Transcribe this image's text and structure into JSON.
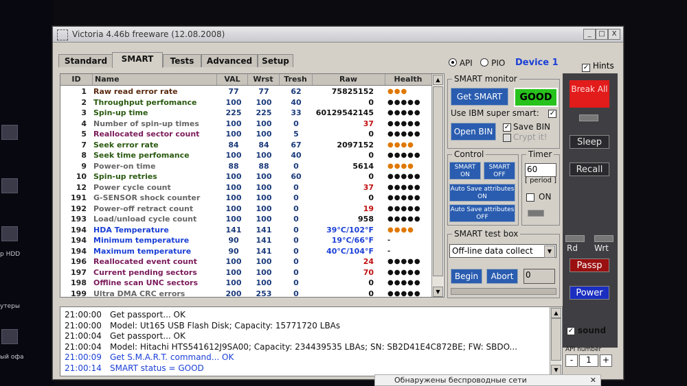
{
  "window": {
    "title": "Victoria 4.46b freeware (12.08.2008)",
    "minimize": "_",
    "maximize": "□",
    "close": "X"
  },
  "tabs": [
    "Standard",
    "SMART",
    "Tests",
    "Advanced",
    "Setup"
  ],
  "active_tab": "SMART",
  "mode": {
    "api": "API",
    "pio": "PIO",
    "selected": "API"
  },
  "device_label": "Device 1",
  "hints": {
    "label": "Hints",
    "checked": true
  },
  "table": {
    "headers": [
      "ID",
      "Name",
      "VAL",
      "Wrst",
      "Tresh",
      "Raw",
      "Health"
    ],
    "rows": [
      {
        "id": "1",
        "name": "Raw read error rate",
        "val": "77",
        "wrst": "77",
        "tresh": "62",
        "raw": "75825152",
        "health": "●●●",
        "name_color": "#5a2a10",
        "raw_color": "#111",
        "health_color": "#e07800"
      },
      {
        "id": "2",
        "name": "Throughput perfomance",
        "val": "100",
        "wrst": "100",
        "tresh": "40",
        "raw": "0",
        "health": "●●●●●",
        "name_color": "#2a5a10",
        "raw_color": "#111",
        "health_color": "#111"
      },
      {
        "id": "3",
        "name": "Spin-up time",
        "val": "225",
        "wrst": "225",
        "tresh": "33",
        "raw": "60129542145",
        "health": "●●●●●",
        "name_color": "#2a5a10",
        "raw_color": "#111",
        "health_color": "#111"
      },
      {
        "id": "4",
        "name": "Number of spin-up times",
        "val": "100",
        "wrst": "100",
        "tresh": "0",
        "raw": "37",
        "health": "●●●●●",
        "name_color": "#666",
        "raw_color": "#c01010",
        "health_color": "#111"
      },
      {
        "id": "5",
        "name": "Reallocated sector count",
        "val": "100",
        "wrst": "100",
        "tresh": "5",
        "raw": "0",
        "health": "●●●●●",
        "name_color": "#7a1a5a",
        "raw_color": "#111",
        "health_color": "#111"
      },
      {
        "id": "7",
        "name": "Seek error rate",
        "val": "84",
        "wrst": "84",
        "tresh": "67",
        "raw": "2097152",
        "health": "●●●●",
        "name_color": "#2a5a10",
        "raw_color": "#111",
        "health_color": "#e07800"
      },
      {
        "id": "8",
        "name": "Seek time perfomance",
        "val": "100",
        "wrst": "100",
        "tresh": "40",
        "raw": "0",
        "health": "●●●●●",
        "name_color": "#2a5a10",
        "raw_color": "#111",
        "health_color": "#111"
      },
      {
        "id": "9",
        "name": "Power-on time",
        "val": "88",
        "wrst": "88",
        "tresh": "0",
        "raw": "5614",
        "health": "●●●●",
        "name_color": "#666",
        "raw_color": "#111",
        "health_color": "#e07800"
      },
      {
        "id": "10",
        "name": "Spin-up retries",
        "val": "100",
        "wrst": "100",
        "tresh": "60",
        "raw": "0",
        "health": "●●●●●",
        "name_color": "#2a5a10",
        "raw_color": "#111",
        "health_color": "#111"
      },
      {
        "id": "12",
        "name": "Power cycle count",
        "val": "100",
        "wrst": "100",
        "tresh": "0",
        "raw": "37",
        "health": "●●●●●",
        "name_color": "#666",
        "raw_color": "#c01010",
        "health_color": "#111"
      },
      {
        "id": "191",
        "name": "G-SENSOR shock counter",
        "val": "100",
        "wrst": "100",
        "tresh": "0",
        "raw": "0",
        "health": "●●●●●",
        "name_color": "#666",
        "raw_color": "#111",
        "health_color": "#111"
      },
      {
        "id": "192",
        "name": "Power-off retract count",
        "val": "100",
        "wrst": "100",
        "tresh": "0",
        "raw": "19",
        "health": "●●●●●",
        "name_color": "#666",
        "raw_color": "#c01010",
        "health_color": "#111"
      },
      {
        "id": "193",
        "name": "Load/unload cycle count",
        "val": "100",
        "wrst": "100",
        "tresh": "0",
        "raw": "958",
        "health": "●●●●●",
        "name_color": "#666",
        "raw_color": "#111",
        "health_color": "#111"
      },
      {
        "id": "194",
        "name": "HDA Temperature",
        "val": "141",
        "wrst": "141",
        "tresh": "0",
        "raw": "39°C/102°F",
        "health": "●●●●",
        "name_color": "#1a3fd6",
        "raw_color": "#1a3fd6",
        "health_color": "#e07800"
      },
      {
        "id": "194",
        "name": "Minimum temperature",
        "val": "90",
        "wrst": "141",
        "tresh": "0",
        "raw": "19°C/66°F",
        "health": "-",
        "name_color": "#1a3fd6",
        "raw_color": "#1a3fd6",
        "health_color": "#111"
      },
      {
        "id": "194",
        "name": "Maximum temperature",
        "val": "90",
        "wrst": "141",
        "tresh": "0",
        "raw": "40°C/104°F",
        "health": "-",
        "name_color": "#1a3fd6",
        "raw_color": "#1a3fd6",
        "health_color": "#111"
      },
      {
        "id": "196",
        "name": "Reallocated event count",
        "val": "100",
        "wrst": "100",
        "tresh": "0",
        "raw": "24",
        "health": "●●●●●",
        "name_color": "#7a1a5a",
        "raw_color": "#c01010",
        "health_color": "#111"
      },
      {
        "id": "197",
        "name": "Current pending sectors",
        "val": "100",
        "wrst": "100",
        "tresh": "0",
        "raw": "70",
        "health": "●●●●●",
        "name_color": "#7a1a5a",
        "raw_color": "#c01010",
        "health_color": "#111"
      },
      {
        "id": "198",
        "name": "Offline scan UNC sectors",
        "val": "100",
        "wrst": "100",
        "tresh": "0",
        "raw": "0",
        "health": "●●●●●",
        "name_color": "#7a1a5a",
        "raw_color": "#111",
        "health_color": "#111"
      },
      {
        "id": "199",
        "name": "Ultra DMA CRC errors",
        "val": "200",
        "wrst": "253",
        "tresh": "0",
        "raw": "0",
        "health": "●●●●●",
        "name_color": "#666",
        "raw_color": "#111",
        "health_color": "#111"
      }
    ]
  },
  "smart_monitor": {
    "title": "SMART monitor",
    "get_smart": "Get SMART",
    "status": "GOOD",
    "status_color": "#27c21c",
    "ibm_label": "Use IBM super smart:",
    "ibm_checked": true,
    "open_bin": "Open BIN",
    "save_bin": "Save BIN",
    "save_bin_checked": true,
    "crypt": "Crypt it!",
    "crypt_checked": false
  },
  "control": {
    "title": "Control",
    "smart_on": "SMART ON",
    "smart_off": "SMART OFF",
    "auto_save_on": "Auto Save attributes ON",
    "auto_save_off": "Auto Save attributes OFF"
  },
  "timer": {
    "title": "Timer",
    "value": "60",
    "period": "[ period ]",
    "on_label": "ON",
    "on_checked": false
  },
  "test_box": {
    "title": "SMART test box",
    "selected": "Off-line data collect",
    "begin": "Begin",
    "abort": "Abort",
    "value": "0"
  },
  "side": {
    "break_all": "Break All",
    "sleep": "Sleep",
    "recall": "Recall",
    "rd": "Rd",
    "wrt": "Wrt",
    "passp": "Passp",
    "power": "Power",
    "sound": "sound",
    "sound_checked": true,
    "api_number_label": "API number",
    "api_number": "1",
    "minus": "-",
    "plus": "+"
  },
  "log": [
    {
      "time": "21:00:00",
      "text": "Get passport... OK",
      "color": "#111"
    },
    {
      "time": "21:00:00",
      "text": "Model: Ut165    USB Flash Disk; Capacity: 15771720 LBAs",
      "color": "#111"
    },
    {
      "time": "21:00:04",
      "text": "Get passport... OK",
      "color": "#111"
    },
    {
      "time": "21:00:04",
      "text": "Model: Hitachi HTS541612J9SA00; Capacity: 234439535 LBAs; SN: SB2D41E4C872BE; FW: SBDO...",
      "color": "#111"
    },
    {
      "time": "21:00:09",
      "text": "Get S.M.A.R.T. command... OK",
      "color": "#1a3fd6"
    },
    {
      "time": "21:00:14",
      "text": "SMART status = GOOD",
      "color": "#1a3fd6"
    }
  ],
  "notification": {
    "text": "Обнаружены беспроводные сети",
    "close": "✕"
  },
  "desktop": {
    "labels": [
      "р HDD",
      "утеры",
      "ый офа"
    ]
  },
  "colors": {
    "accent_blue": "#2a5db0",
    "danger_red": "#e21b1b",
    "good_green": "#27c21c"
  }
}
